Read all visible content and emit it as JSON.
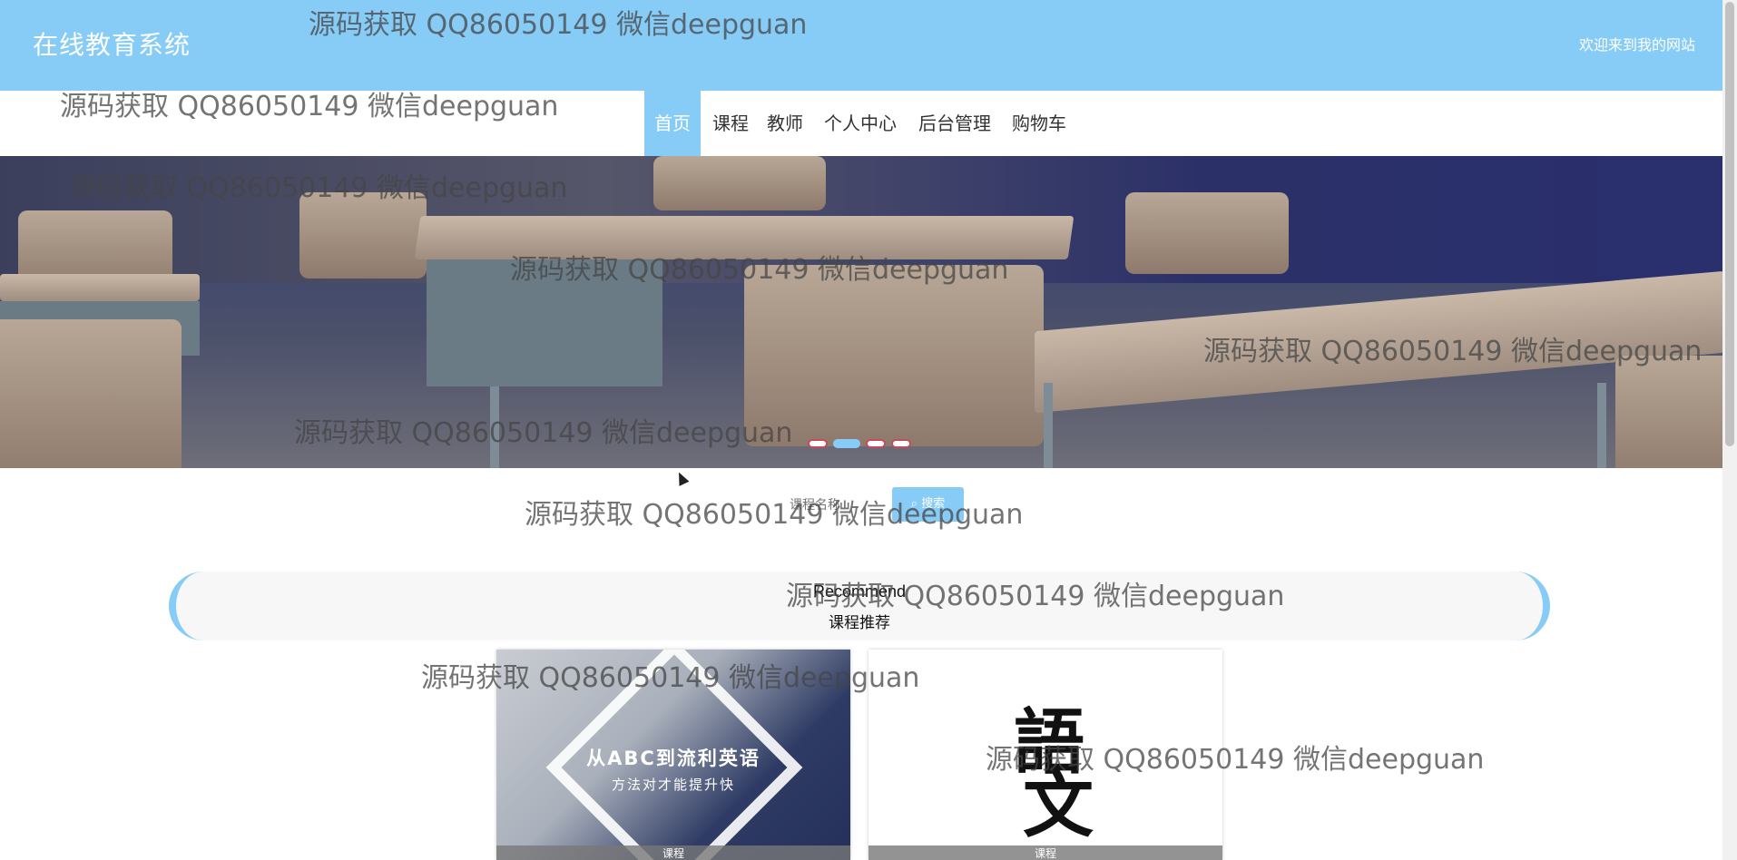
{
  "header": {
    "title": "在线教育系统",
    "welcome": "欢迎来到我的网站"
  },
  "nav": {
    "items": [
      {
        "label": "首页",
        "active": true
      },
      {
        "label": "课程",
        "active": false
      },
      {
        "label": "教师",
        "active": false
      },
      {
        "label": "个人中心",
        "active": false
      },
      {
        "label": "后台管理",
        "active": false
      },
      {
        "label": "购物车",
        "active": false
      }
    ]
  },
  "banner": {
    "dots": [
      {
        "active": false
      },
      {
        "active": true
      },
      {
        "active": false
      },
      {
        "active": false
      }
    ]
  },
  "search": {
    "placeholder": "课程名称",
    "button_label": "搜索",
    "button_icon": "search-icon"
  },
  "recommend": {
    "title_en": "Recommend",
    "title_cn": "课程推荐"
  },
  "cards": [
    {
      "image_text": "从ABC到流利英语",
      "image_subtext": "方法对才能提升快",
      "caption": "课程"
    },
    {
      "image_text": "語",
      "image_subtext": "文",
      "caption": "课程"
    }
  ],
  "watermark": "源码获取 QQ86050149 微信deepguan",
  "colors": {
    "accent": "#87cbf7",
    "header_text": "#ffffff"
  }
}
